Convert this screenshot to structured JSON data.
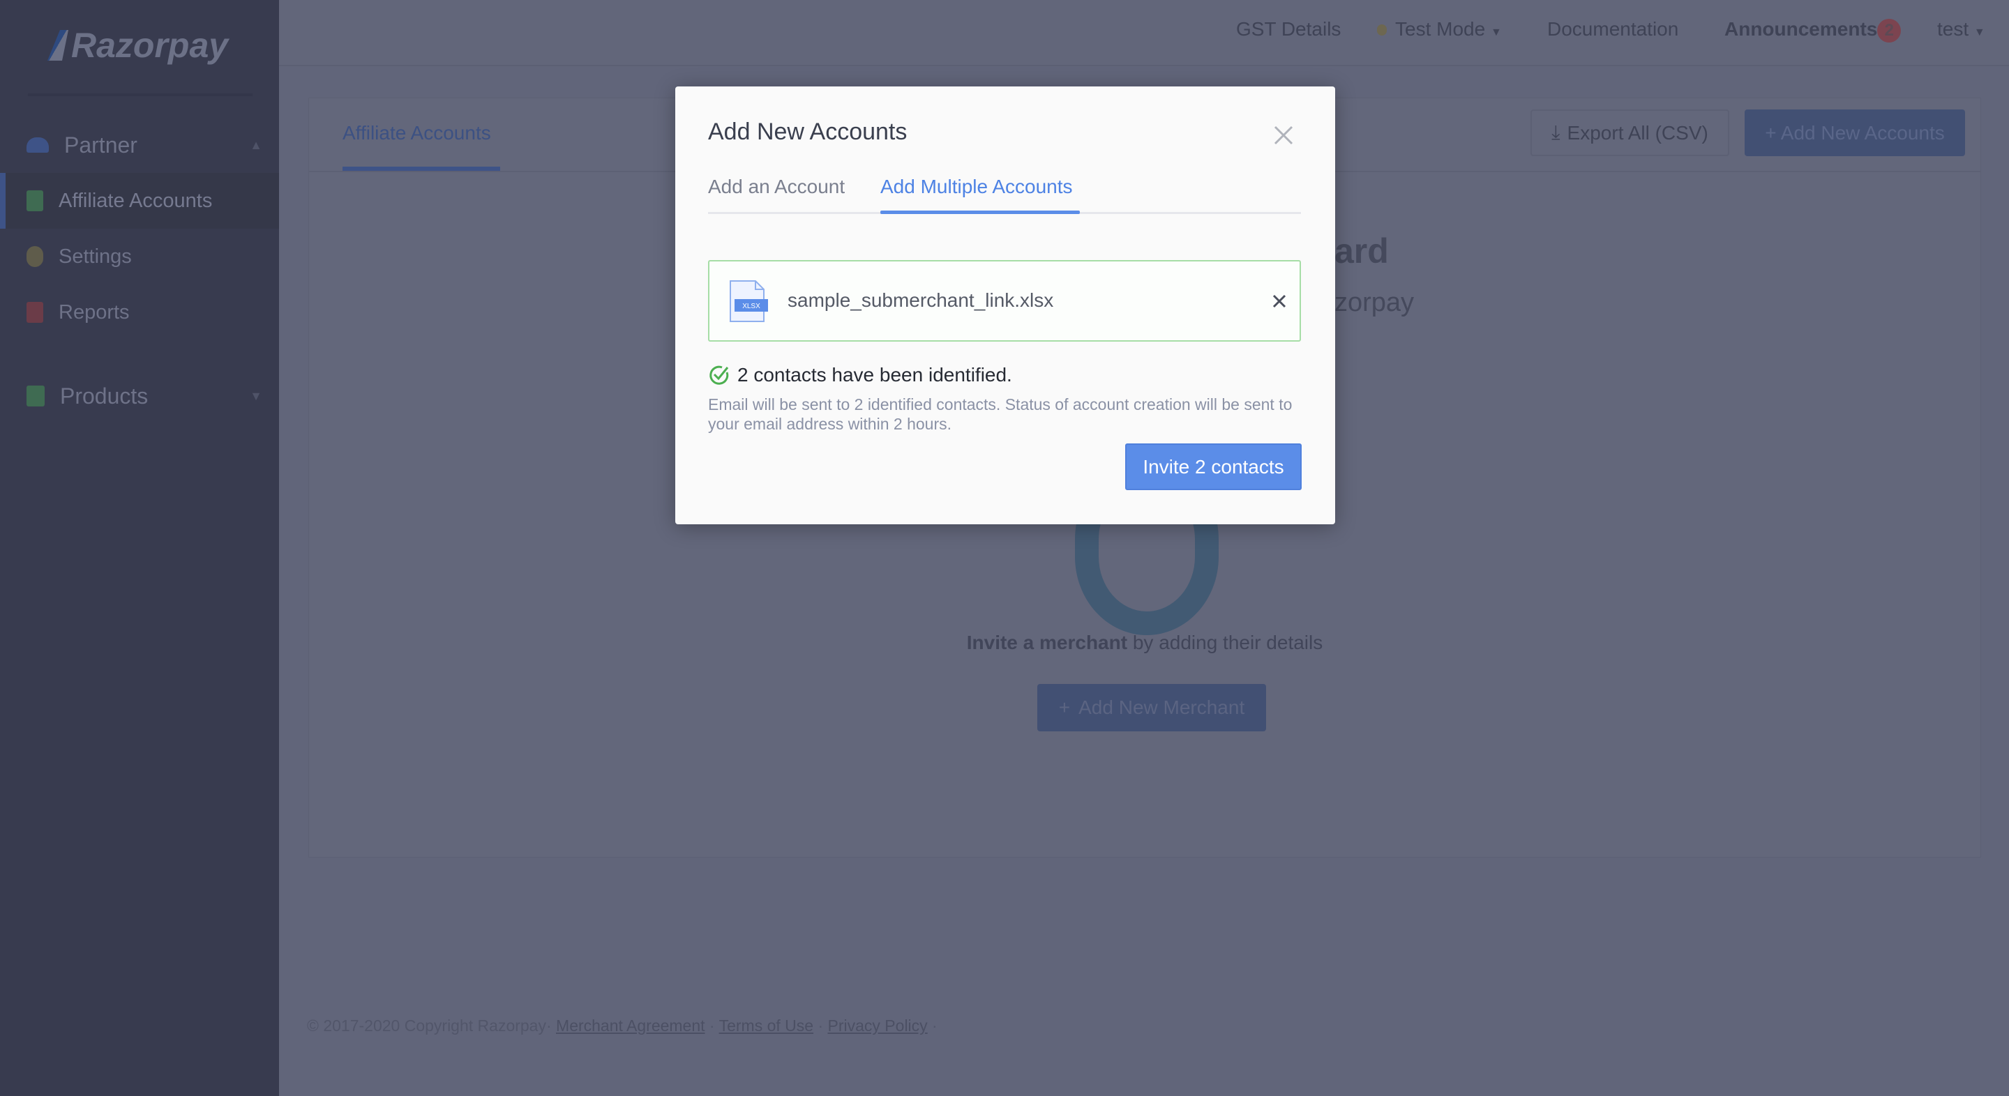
{
  "sidebar": {
    "logo": "Razorpay",
    "sections": [
      {
        "label": "Partner",
        "icon": "people-icon"
      },
      {
        "label": "Products",
        "icon": "grid-icon"
      }
    ],
    "items": [
      {
        "label": "Affiliate Accounts",
        "icon": "bank-icon",
        "active": true
      },
      {
        "label": "Settings",
        "icon": "gear-icon"
      },
      {
        "label": "Reports",
        "icon": "report-icon"
      }
    ]
  },
  "header": {
    "gst": "GST Details",
    "mode": "Test Mode",
    "docs": "Documentation",
    "announcements": "Announcements",
    "announcements_count": "2",
    "user": "test"
  },
  "main": {
    "tab": "Affiliate Accounts",
    "export": "Export All (CSV)",
    "add_accounts": "+ Add New Accounts",
    "hero_fragment_1": "ard",
    "hero_fragment_2": "zorpay",
    "invite_bold": "Invite a merchant",
    "invite_rest": " by adding their details",
    "add_merchant": "Add New Merchant"
  },
  "footer": {
    "copyright": "© 2017-2020 Copyright Razorpay·",
    "links": [
      "Merchant Agreement",
      "Terms of Use",
      "Privacy Policy"
    ]
  },
  "modal": {
    "title": "Add New Accounts",
    "tabs": [
      {
        "label": "Add an Account",
        "active": false
      },
      {
        "label": "Add Multiple Accounts",
        "active": true
      }
    ],
    "file": {
      "name": "sample_submerchant_link.xlsx",
      "type": "XLSX"
    },
    "status": "2 contacts have been identified.",
    "description": "Email will be sent to 2 identified contacts. Status of account creation will be sent to your email address within 2 hours.",
    "invite_button": "Invite 2 contacts"
  },
  "colors": {
    "accent": "#5b8de8",
    "success": "#4caf50",
    "file_border": "#a6dda6"
  }
}
